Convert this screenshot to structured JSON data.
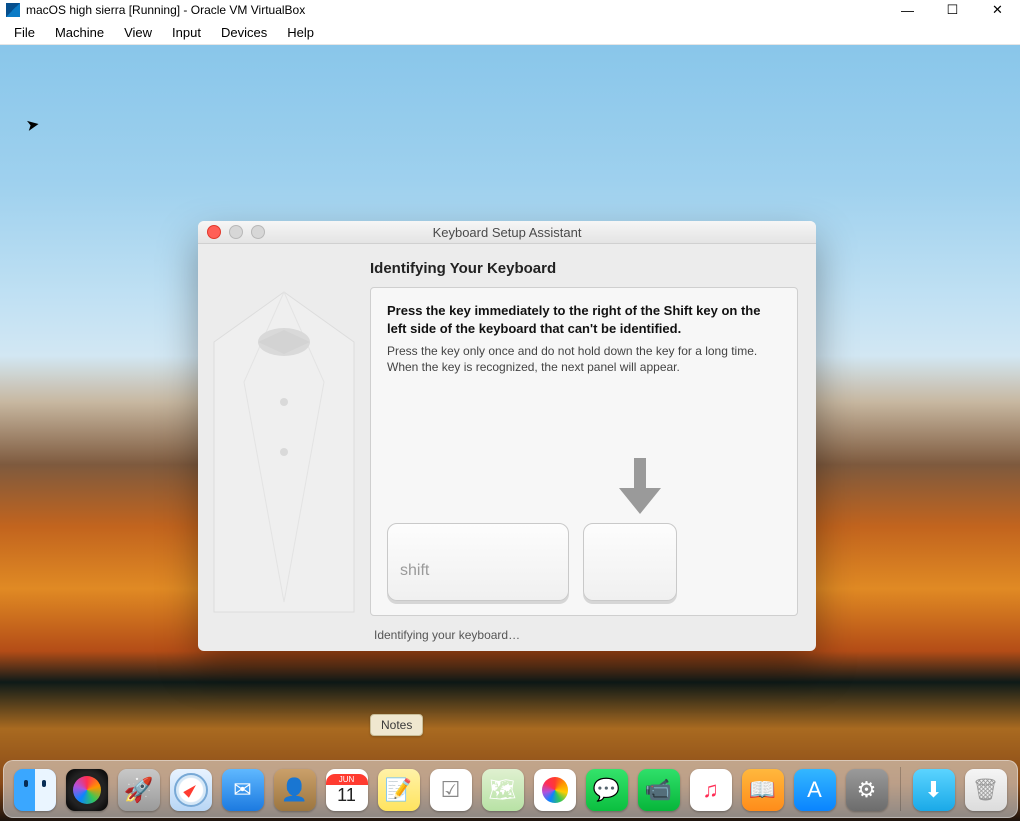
{
  "window": {
    "title": "macOS high sierra [Running] - Oracle VM VirtualBox",
    "controls": {
      "min": "—",
      "max": "☐",
      "close": "✕"
    }
  },
  "menu": [
    "File",
    "Machine",
    "View",
    "Input",
    "Devices",
    "Help"
  ],
  "dialog": {
    "title": "Keyboard Setup Assistant",
    "heading": "Identifying Your Keyboard",
    "instruction_bold": "Press the key immediately to the right of the Shift key on the left side of the keyboard that can't be identified.",
    "instruction_sub": "Press the key only once and do not hold down the key for a long time. When the key is recognized, the next panel will appear.",
    "shift_label": "shift",
    "status": "Identifying your keyboard…"
  },
  "tooltip": "Notes",
  "calendar": {
    "month": "JUN",
    "day": "11"
  },
  "dock": [
    {
      "name": "finder",
      "label": "Finder"
    },
    {
      "name": "siri",
      "label": "Siri"
    },
    {
      "name": "launchpad",
      "label": "Launchpad"
    },
    {
      "name": "safari",
      "label": "Safari"
    },
    {
      "name": "mail",
      "label": "Mail"
    },
    {
      "name": "contacts",
      "label": "Contacts"
    },
    {
      "name": "calendar",
      "label": "Calendar"
    },
    {
      "name": "notes",
      "label": "Notes"
    },
    {
      "name": "reminders",
      "label": "Reminders"
    },
    {
      "name": "maps",
      "label": "Maps"
    },
    {
      "name": "photos",
      "label": "Photos"
    },
    {
      "name": "messages",
      "label": "Messages"
    },
    {
      "name": "facetime",
      "label": "FaceTime"
    },
    {
      "name": "itunes",
      "label": "iTunes"
    },
    {
      "name": "ibooks",
      "label": "iBooks"
    },
    {
      "name": "appstore",
      "label": "App Store"
    },
    {
      "name": "sysprefs",
      "label": "System Preferences"
    }
  ]
}
